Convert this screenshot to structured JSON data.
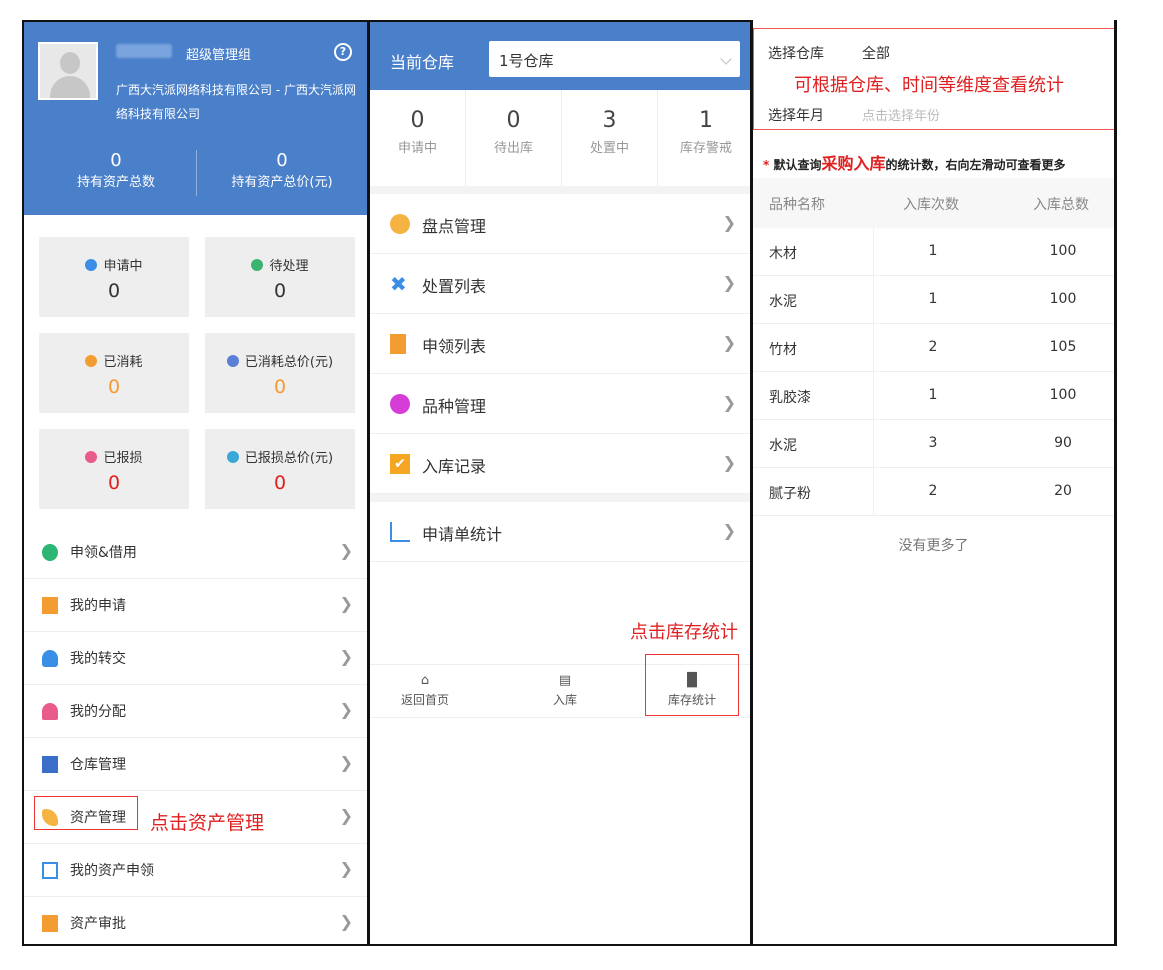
{
  "panel1": {
    "role": "超级管理组",
    "help_icon": "?",
    "company": "广西大汽派网络科技有限公司 - 广西大汽派网络科技有限公司",
    "stats": [
      {
        "value": "0",
        "label": "持有资产总数"
      },
      {
        "value": "0",
        "label": "持有资产总价(元)"
      }
    ],
    "cards": [
      {
        "label": "申请中",
        "value": "0",
        "icon": "applying-icon",
        "icon_color": "#3a8ee6",
        "value_color": "#333333"
      },
      {
        "label": "待处理",
        "value": "0",
        "icon": "pending-icon",
        "icon_color": "#3cb371",
        "value_color": "#333333"
      },
      {
        "label": "已消耗",
        "value": "0",
        "icon": "consumed-icon",
        "icon_color": "#f39c32",
        "value_color": "#f39c32"
      },
      {
        "label": "已消耗总价(元)",
        "value": "0",
        "icon": "consumed-total-icon",
        "icon_color": "#5b7fd6",
        "value_color": "#f39c32"
      },
      {
        "label": "已报损",
        "value": "0",
        "icon": "damaged-icon",
        "icon_color": "#e85b8a",
        "value_color": "#e02020"
      },
      {
        "label": "已报损总价(元)",
        "value": "0",
        "icon": "damaged-total-icon",
        "icon_color": "#3aa7d9",
        "value_color": "#e02020"
      }
    ],
    "menu": [
      {
        "label": "申领&借用",
        "icon": "borrow-icon",
        "color": "#2bb673"
      },
      {
        "label": "我的申请",
        "icon": "my-application-icon",
        "color": "#f39c32"
      },
      {
        "label": "我的转交",
        "icon": "transfer-icon",
        "color": "#3a8ee6"
      },
      {
        "label": "我的分配",
        "icon": "allocation-icon",
        "color": "#e85b8a"
      },
      {
        "label": "仓库管理",
        "icon": "warehouse-icon",
        "color": "#3a6fc9"
      },
      {
        "label": "资产管理",
        "icon": "asset-management-icon",
        "color": "#f5b342"
      },
      {
        "label": "我的资产申领",
        "icon": "asset-claim-icon",
        "color": "#3a8ee6"
      },
      {
        "label": "资产审批",
        "icon": "asset-approval-icon",
        "color": "#f39c32"
      }
    ],
    "annotation": "点击资产管理"
  },
  "panel2": {
    "warehouse_label": "当前仓库",
    "warehouse_value": "1号仓库",
    "counts": [
      {
        "value": "0",
        "label": "申请中"
      },
      {
        "value": "0",
        "label": "待出库"
      },
      {
        "value": "3",
        "label": "处置中"
      },
      {
        "value": "1",
        "label": "库存警戒"
      }
    ],
    "menu": [
      {
        "label": "盘点管理",
        "icon": "inventory-check-icon",
        "color": "#f5b342"
      },
      {
        "label": "处置列表",
        "icon": "disposal-icon",
        "color": "#3a8ee6"
      },
      {
        "label": "申领列表",
        "icon": "claim-list-icon",
        "color": "#f39c32"
      },
      {
        "label": "品种管理",
        "icon": "category-icon",
        "color": "#d63cd6"
      },
      {
        "label": "入库记录",
        "icon": "stock-in-record-icon",
        "color": "#f5a623"
      },
      {
        "label": "申请单统计",
        "icon": "application-stats-icon",
        "color": "#3a8ee6"
      }
    ],
    "annotation": "点击库存统计",
    "tabs": [
      {
        "label": "返回首页",
        "icon": "home-icon"
      },
      {
        "label": "入库",
        "icon": "stock-in-icon"
      },
      {
        "label": "库存统计",
        "icon": "stats-icon"
      }
    ]
  },
  "panel3": {
    "filter": {
      "warehouse_label": "选择仓库",
      "warehouse_value": "全部",
      "month_label": "选择年月",
      "month_placeholder": "点击选择年份"
    },
    "annotation": "可根据仓库、时间等维度查看统计",
    "note": {
      "star": "*",
      "prefix": "默认查询",
      "highlight": "采购入库",
      "suffix": "的统计数，右向左滑动可查看更多"
    },
    "table": {
      "headers": [
        "品种名称",
        "入库次数",
        "入库总数"
      ],
      "rows": [
        [
          "木材",
          "1",
          "100"
        ],
        [
          "水泥",
          "1",
          "100"
        ],
        [
          "竹材",
          "2",
          "105"
        ],
        [
          "乳胶漆",
          "1",
          "100"
        ],
        [
          "水泥",
          "3",
          "90"
        ],
        [
          "腻子粉",
          "2",
          "20"
        ]
      ]
    },
    "no_more": "没有更多了"
  }
}
